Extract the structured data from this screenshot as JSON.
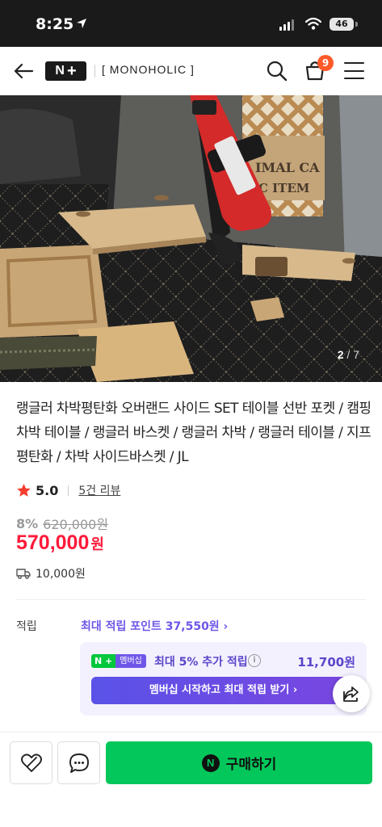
{
  "status_bar": {
    "time": "8:25",
    "battery": "46"
  },
  "header": {
    "logo_n": "N",
    "logo_plus": "+",
    "brand": "[ MONOHOLIC ]",
    "cart_count": "9"
  },
  "gallery": {
    "current": "2",
    "total": "/ 7"
  },
  "product": {
    "title": "랭글러 차박평탄화 오버랜드 사이드 SET 테이블 선반 포켓 / 캠핑 차박 테이블 / 랭글러 바스켓 / 랭글러 차박 / 랭글러 테이블 / 지프 평탄화 / 차박 사이드바스켓 / JL",
    "rating": "5.0",
    "review_link": "5건 리뷰",
    "discount_rate": "8%",
    "original_price": "620,000원",
    "price": "570,000",
    "price_unit": "원",
    "shipping_fee": "10,000원"
  },
  "points": {
    "label": "적립",
    "max_points_link": "최대 적립 포인트 37,550원 ›",
    "member_logo": "N +",
    "member_tag": "멤버십",
    "member_text": "최대 5% 추가 적립",
    "info": "i",
    "member_amount": "11,700원",
    "member_button": "멤버십 시작하고 최대 적립 받기 ›"
  },
  "bottom_bar": {
    "buy_n": "N",
    "buy_label": "구매하기"
  },
  "colors": {
    "price_red": "#ff1a3a",
    "naver_green": "#03c75a",
    "membership_purple": "#6f56e8",
    "cart_badge": "#ff5a2a"
  },
  "icons": [
    "back-arrow-icon",
    "search-icon",
    "cart-icon",
    "menu-icon",
    "star-icon",
    "truck-icon",
    "info-icon",
    "share-icon",
    "heart-icon",
    "chat-icon"
  ]
}
